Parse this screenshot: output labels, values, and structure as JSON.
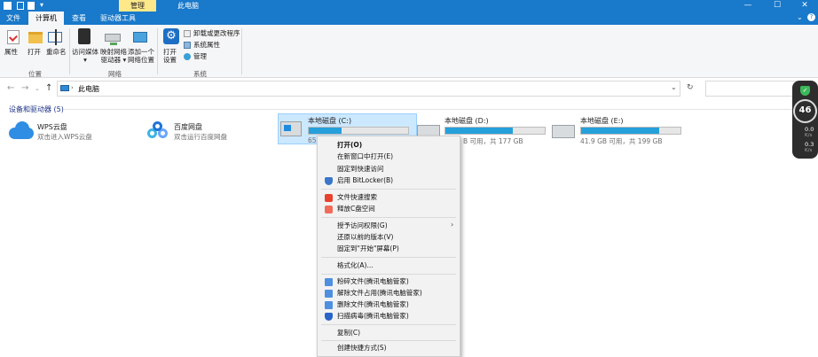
{
  "titlebar": {
    "title": "此电脑",
    "context_tab": "管理"
  },
  "tabs": {
    "file": "文件",
    "computer": "计算机",
    "view": "查看",
    "drive_tools": "驱动器工具"
  },
  "ribbon": {
    "properties": "属性",
    "open": "打开",
    "rename": "重命名",
    "access_media_l1": "访问媒体",
    "map_drive_l1": "映射网络",
    "map_drive_l2": "驱动器",
    "add_netloc_l1": "添加一个",
    "add_netloc_l2": "网络位置",
    "open_settings_l1": "打开",
    "open_settings_l2": "设置",
    "uninstall": "卸载或更改程序",
    "system_props": "系统属性",
    "manage": "管理",
    "group_location": "位置",
    "group_network": "网络",
    "group_system": "系统"
  },
  "address": {
    "path": "此电脑"
  },
  "content": {
    "group_header": "设备和驱动器 (5)",
    "wps_name": "WPS云盘",
    "wps_sub": "双击进入WPS云盘",
    "baidu_name": "百度网盘",
    "baidu_sub": "双击运行百度网盘",
    "c_name": "本地磁盘 (C:)",
    "c_sub": "65.",
    "c_used_fraction": 0.33,
    "d_name": "本地磁盘 (D:)",
    "d_sub": "B 可用，共 177 GB",
    "d_used_fraction": 0.68,
    "e_name": "本地磁盘 (E:)",
    "e_sub": "41.9 GB 可用，共 199 GB",
    "e_used_fraction": 0.79
  },
  "menu": {
    "open": "打开(O)",
    "open_new_window": "在新窗口中打开(E)",
    "pin_quick": "固定到快速访问",
    "bitlocker": "启用 BitLocker(B)",
    "file_search": "文件快速搜索",
    "free_c": "释放C盘空间",
    "grant_access": "授予访问权限(G)",
    "restore": "还原以前的版本(V)",
    "pin_start": "固定到\"开始\"屏幕(P)",
    "format": "格式化(A)...",
    "shred": "粉碎文件(腾讯电脑管家)",
    "unlock": "解除文件占用(腾讯电脑管家)",
    "delete": "删除文件(腾讯电脑管家)",
    "scan": "扫描病毒(腾讯电脑管家)",
    "copy": "复制(C)",
    "shortcut": "创建快捷方式(S)"
  },
  "widget": {
    "score": "46",
    "up": "0.0",
    "up_unit": "K/s",
    "down": "0.3",
    "down_unit": "K/s"
  },
  "colors": {
    "titlebar": "#1979ca",
    "accent": "#26a0da",
    "context_tab": "#ffe889"
  }
}
